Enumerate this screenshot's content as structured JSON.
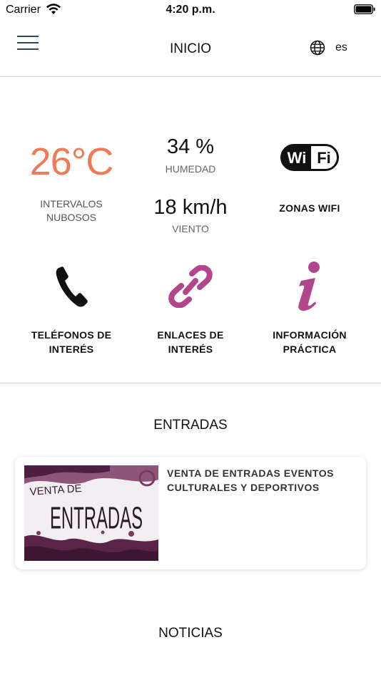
{
  "status_bar": {
    "carrier": "Carrier",
    "time": "4:20 p.m."
  },
  "header": {
    "title": "INICIO",
    "language": "es"
  },
  "weather": {
    "temperature": "26°C",
    "description_line1": "INTERVALOS",
    "description_line2": "NUBOSOS",
    "humidity_value": "34 %",
    "humidity_label": "HUMEDAD",
    "wind_value": "18 km/h",
    "wind_label": "VIENTO"
  },
  "tiles": {
    "wifi": {
      "logo_text_left": "Wi",
      "logo_text_right": "Fi",
      "label": "ZONAS WIFI"
    },
    "phones": {
      "label_line1": "TELÉFONOS DE",
      "label_line2": "INTERÉS"
    },
    "links": {
      "label_line1": "ENLACES DE",
      "label_line2": "INTERÉS"
    },
    "info": {
      "label_line1": "INFORMACIÓN",
      "label_line2": "PRÁCTICA"
    }
  },
  "sections": {
    "entradas": {
      "title": "ENTRADAS",
      "card": {
        "title_line1": "VENTA DE ENTRADAS EVENTOS",
        "title_line2": "CULTURALES Y DEPORTIVOS",
        "image_text_small": "VENTA DE",
        "image_text_big": "ENTRADAS"
      }
    },
    "noticias": {
      "title": "NOTICIAS"
    }
  },
  "colors": {
    "accent_orange": "#f07a55",
    "accent_magenta": "#b2468c",
    "menu_icon": "#2a4a5e"
  }
}
